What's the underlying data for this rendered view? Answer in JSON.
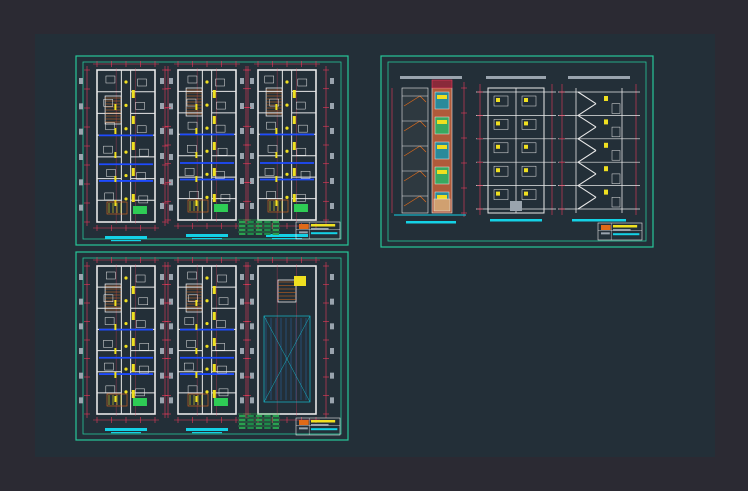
{
  "window": {
    "background": "#2b2a33",
    "viewport_color": "#232f38"
  },
  "colors": {
    "sheet_border": "#27c79a",
    "wall": "#e8e8e8",
    "dimension": "#e83a5a",
    "structure": "#1e4bff",
    "cyan": "#14d2e6",
    "yellow": "#f0e020",
    "orange": "#e06a18",
    "green": "#2ecc55",
    "gray": "#9aa4ae"
  },
  "sheets": [
    {
      "id": "sheet-floor-plans-upper",
      "icon": "drawing-sheet-icon",
      "kind": "plans",
      "plans": 3,
      "stair_variant": "plan"
    },
    {
      "id": "sheet-elevations-sections",
      "icon": "drawing-sheet-icon",
      "kind": "sections",
      "plans": 3,
      "stair_variant": "section"
    },
    {
      "id": "sheet-floor-plans-lower",
      "icon": "drawing-sheet-icon",
      "kind": "plans",
      "plans": 3,
      "stair_variant": "roof"
    }
  ]
}
